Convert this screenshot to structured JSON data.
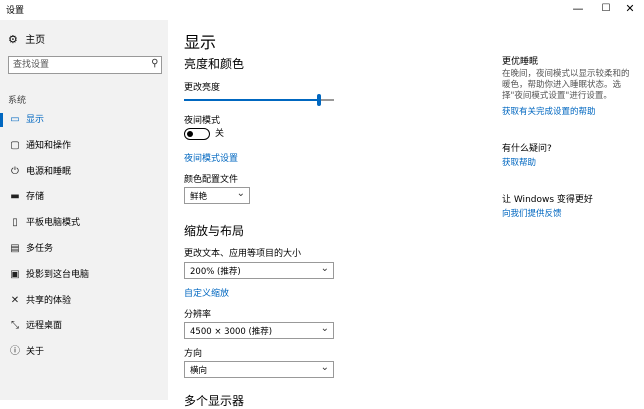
{
  "window": {
    "title": "设置",
    "controls": {
      "minimize": "—",
      "maximize": "☐",
      "close": "✕"
    }
  },
  "sidebar": {
    "home": "主页",
    "search_placeholder": "查找设置",
    "section": "系统",
    "items": [
      {
        "label": "显示",
        "icon": "monitor-icon",
        "active": true
      },
      {
        "label": "通知和操作",
        "icon": "message-icon"
      },
      {
        "label": "电源和睡眠",
        "icon": "power-icon"
      },
      {
        "label": "存储",
        "icon": "storage-icon"
      },
      {
        "label": "平板电脑模式",
        "icon": "tablet-icon"
      },
      {
        "label": "多任务",
        "icon": "multitask-icon"
      },
      {
        "label": "投影到这台电脑",
        "icon": "project-icon"
      },
      {
        "label": "共享的体验",
        "icon": "shared-experience-icon"
      },
      {
        "label": "远程桌面",
        "icon": "remote-desktop-icon"
      },
      {
        "label": "关于",
        "icon": "info-icon"
      }
    ]
  },
  "main": {
    "title": "显示",
    "brightness_heading": "亮度和颜色",
    "brightness_label": "更改亮度",
    "brightness_value": 0.9,
    "night_light_label": "夜间模式",
    "night_light_state": "关",
    "night_light_settings_link": "夜间模式设置",
    "color_profile_label": "颜色配置文件",
    "color_profile_value": "鲜艳",
    "scale_heading": "缩放与布局",
    "scale_label": "更改文本、应用等项目的大小",
    "scale_value": "200% (推荐)",
    "custom_scale_link": "自定义缩放",
    "resolution_label": "分辨率",
    "resolution_value": "4500 × 3000 (推荐)",
    "orientation_label": "方向",
    "orientation_value": "横向",
    "multi_display_heading": "多个显示器"
  },
  "right_panel": {
    "sleep_heading": "更优睡眠",
    "sleep_text": "在晚间，夜间模式以显示较柔和的暖色，帮助你进入睡眠状态。选择\"夜间模式设置\"进行设置。",
    "sleep_link": "获取有关完成设置的帮助",
    "question_heading": "有什么疑问?",
    "help_link": "获取帮助",
    "better_heading": "让 Windows 变得更好",
    "feedback_link": "向我们提供反馈"
  }
}
